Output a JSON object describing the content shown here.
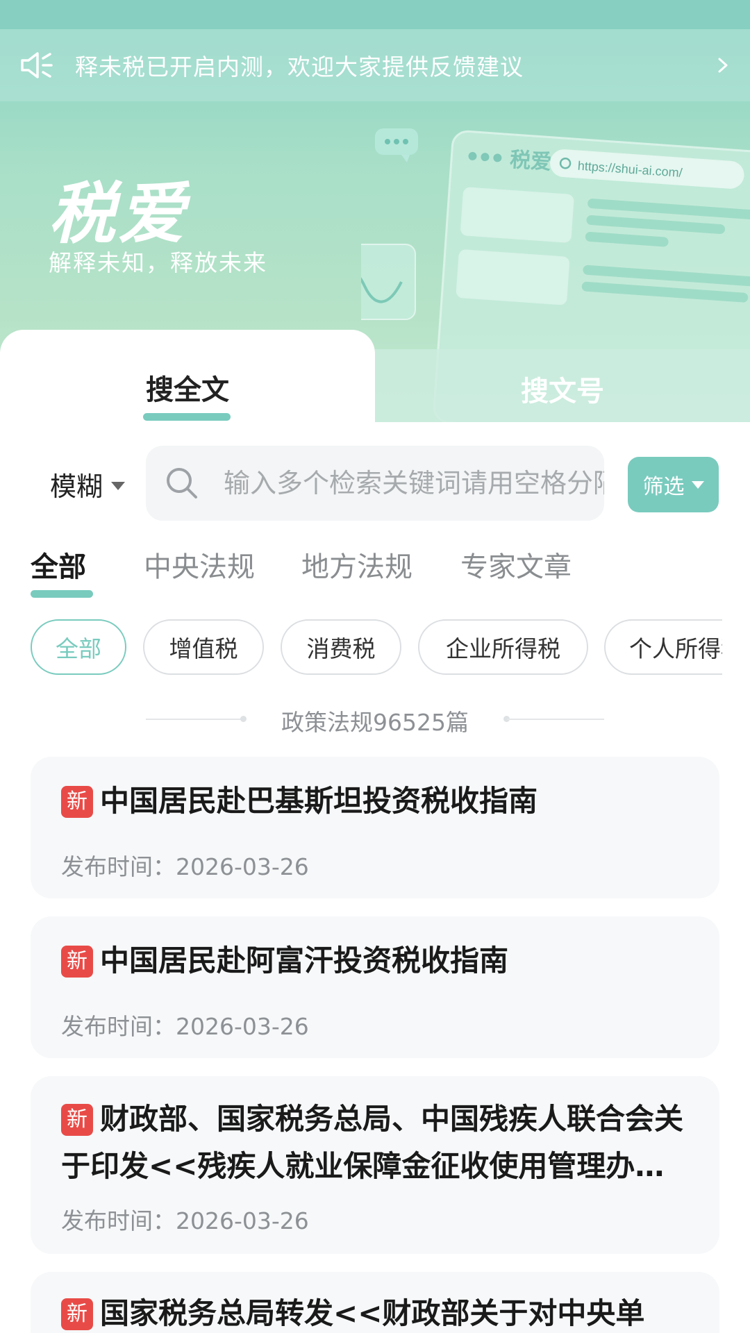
{
  "notice": {
    "text": "释未税已开启内测，欢迎大家提供反馈建议"
  },
  "brand": {
    "title": "税爱",
    "subtitle": "解释未知，释放未来"
  },
  "illustration": {
    "browser_label": "税爱",
    "url": "https://shui-ai.com/"
  },
  "mode_tabs": [
    {
      "label": "搜全文",
      "active": true
    },
    {
      "label": "搜文号",
      "active": false
    }
  ],
  "search": {
    "mode_label": "模糊",
    "placeholder": "输入多个检索关键词请用空格分隔",
    "filter_label": "筛选"
  },
  "categories": [
    {
      "label": "全部",
      "active": true
    },
    {
      "label": "中央法规",
      "active": false
    },
    {
      "label": "地方法规",
      "active": false
    },
    {
      "label": "专家文章",
      "active": false
    }
  ],
  "tax_chips": [
    {
      "label": "全部",
      "active": true
    },
    {
      "label": "增值税",
      "active": false
    },
    {
      "label": "消费税",
      "active": false
    },
    {
      "label": "企业所得税",
      "active": false
    },
    {
      "label": "个人所得税",
      "active": false
    }
  ],
  "count_text": "政策法规96525篇",
  "results": [
    {
      "badge": "新",
      "title": "中国居民赴巴基斯坦投资税收指南",
      "date": "发布时间：2026-03-26"
    },
    {
      "badge": "新",
      "title": "中国居民赴阿富汗投资税收指南",
      "date": "发布时间：2026-03-26"
    },
    {
      "badge": "新",
      "title": "财政部、国家税务总局、中国残疾人联合会关于印发<<残疾人就业保障金征收使用管理办法>>的通知",
      "date": "发布时间：2026-03-26"
    },
    {
      "badge": "新",
      "title": "国家税务总局转发<<财政部关于对中央单",
      "date": ""
    }
  ],
  "colors": {
    "accent": "#79cbbe",
    "badge_red": "#e84b47",
    "hero_top": "#86d2c2"
  }
}
